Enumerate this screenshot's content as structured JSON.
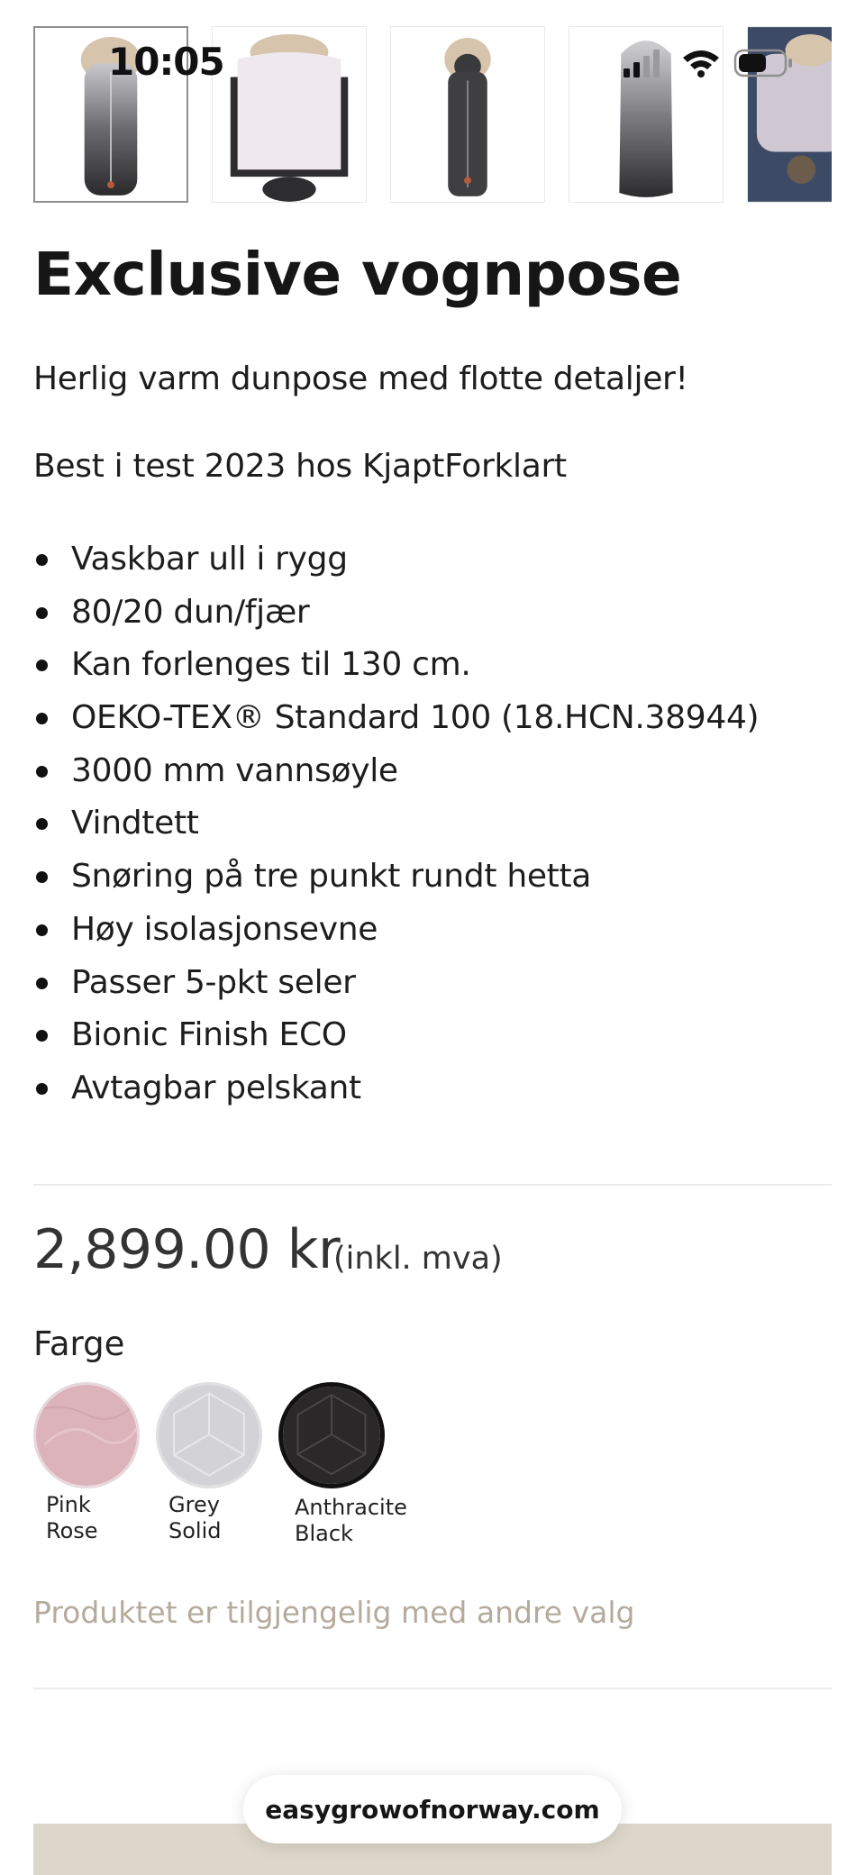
{
  "status_bar": {
    "time": "10:05"
  },
  "gallery": {
    "thumbnails": [
      {
        "icon": "footmuff-front-image",
        "selected": true
      },
      {
        "icon": "footmuff-open-image",
        "selected": false
      },
      {
        "icon": "footmuff-hood-image",
        "selected": false
      },
      {
        "icon": "footmuff-back-image",
        "selected": false
      },
      {
        "icon": "stroller-photo-image",
        "selected": false
      }
    ]
  },
  "product": {
    "title": "Exclusive vognpose",
    "tagline": "Herlig varm dunpose med flotte detaljer!",
    "award": "Best i test 2023 hos KjaptForklart",
    "features": [
      "Vaskbar ull i rygg",
      "80/20 dun/fjær",
      "Kan forlenges til 130 cm.",
      "OEKO-TEX® Standard 100 (18.HCN.38944)",
      "3000 mm vannsøyle",
      "Vindtett",
      "Snøring på tre punkt rundt hetta",
      "Høy isolasjonsevne",
      "Passer 5-pkt seler",
      "Bionic Finish ECO",
      "Avtagbar pelskant"
    ],
    "price": "2,899.00 kr",
    "price_note": "(inkl. mva)",
    "color_label": "Farge",
    "colors": [
      {
        "line1": "Pink",
        "line2": "Rose",
        "hex": "#dcb2bb",
        "selected": false
      },
      {
        "line1": "Grey",
        "line2": "Solid",
        "hex": "#d3d2d6",
        "selected": false
      },
      {
        "line1": "Anthracite",
        "line2": "Black",
        "hex": "#2a2828",
        "selected": true
      }
    ],
    "availability_note": "Produktet er tilgjengelig med andre valg"
  },
  "browser": {
    "url": "easygrowofnorway.com"
  },
  "theme": {
    "accent_beige": "#ddd6ca",
    "muted_text": "#b5ab9d"
  }
}
